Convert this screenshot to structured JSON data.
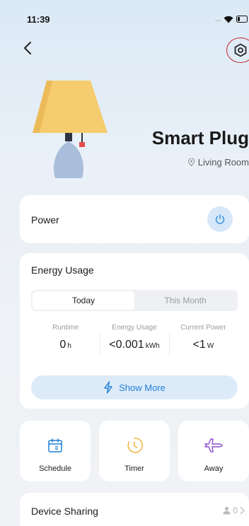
{
  "status_bar": {
    "time": "11:39",
    "signal_dots": "...."
  },
  "colors": {
    "accent": "#1f7fd7",
    "power_bg": "#d6e8f8",
    "timer": "#f0b53a",
    "away": "#8b4fd1",
    "highlight_ring": "#c0262d"
  },
  "header": {
    "back_icon": "chevron-left-icon",
    "settings_icon": "hexagon-settings-icon"
  },
  "device": {
    "name": "Smart Plug",
    "location": "Living Room"
  },
  "power": {
    "label": "Power"
  },
  "energy": {
    "title": "Energy Usage",
    "tabs": [
      {
        "label": "Today",
        "active": true
      },
      {
        "label": "This Month",
        "active": false
      }
    ],
    "metrics": [
      {
        "label": "Runtime",
        "value": "0",
        "unit": "h"
      },
      {
        "label": "Energy Usage",
        "value": "<0.001",
        "unit": "kWh"
      },
      {
        "label": "Current Power",
        "value": "<1",
        "unit": "W"
      }
    ],
    "show_more": "Show More"
  },
  "shortcuts": [
    {
      "label": "Schedule",
      "icon": "calendar-icon"
    },
    {
      "label": "Timer",
      "icon": "clock-icon"
    },
    {
      "label": "Away",
      "icon": "airplane-icon"
    }
  ],
  "sharing": {
    "label": "Device Sharing",
    "count": "0"
  }
}
